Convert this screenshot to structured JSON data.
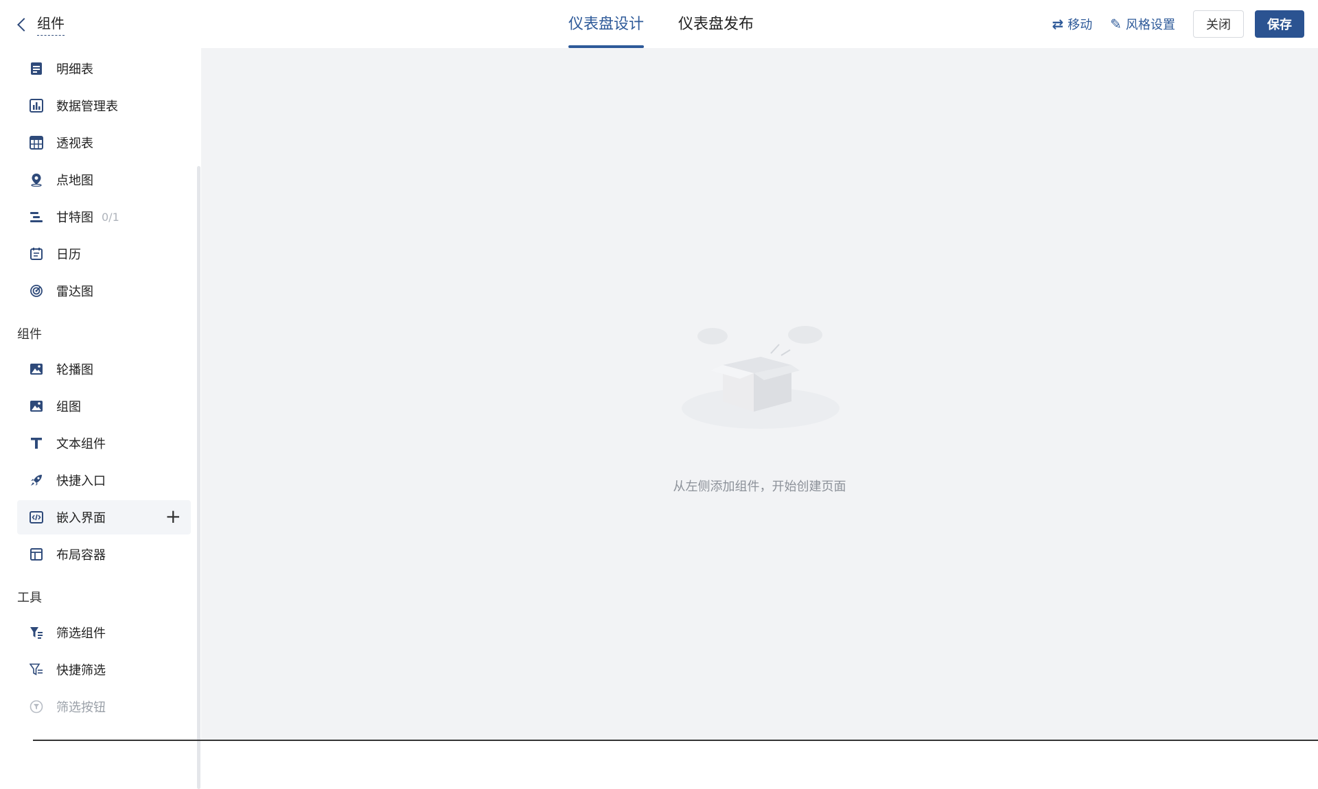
{
  "header": {
    "back_label": "组件",
    "tabs": [
      {
        "label": "仪表盘设计",
        "active": true
      },
      {
        "label": "仪表盘发布",
        "active": false
      }
    ],
    "move_label": "移动",
    "style_label": "风格设置",
    "close_label": "关闭",
    "save_label": "保存"
  },
  "sidebar": {
    "charts": [
      {
        "label": "明细表",
        "icon": "table-doc-icon"
      },
      {
        "label": "数据管理表",
        "icon": "bar-chart-icon"
      },
      {
        "label": "透视表",
        "icon": "pivot-table-icon"
      },
      {
        "label": "点地图",
        "icon": "map-pin-icon"
      },
      {
        "label": "甘特图",
        "icon": "gantt-icon",
        "badge": "0/1"
      },
      {
        "label": "日历",
        "icon": "calendar-icon"
      },
      {
        "label": "雷达图",
        "icon": "radar-icon"
      }
    ],
    "section_components": "组件",
    "components": [
      {
        "label": "轮播图",
        "icon": "image-icon"
      },
      {
        "label": "组图",
        "icon": "image-icon"
      },
      {
        "label": "文本组件",
        "icon": "text-icon"
      },
      {
        "label": "快捷入口",
        "icon": "rocket-icon"
      },
      {
        "label": "嵌入界面",
        "icon": "code-icon"
      },
      {
        "label": "布局容器",
        "icon": "layout-icon"
      }
    ],
    "section_tools": "工具",
    "tools": [
      {
        "label": "筛选组件",
        "icon": "filter-icon"
      },
      {
        "label": "快捷筛选",
        "icon": "filter-list-icon"
      },
      {
        "label": "筛选按钮",
        "icon": "filter-circle-icon"
      }
    ]
  },
  "canvas": {
    "empty_message": "从左侧添加组件，开始创建页面"
  },
  "colors": {
    "accent": "#2b5391",
    "icon": "#2e4a7a",
    "canvas": "#f2f3f5"
  }
}
